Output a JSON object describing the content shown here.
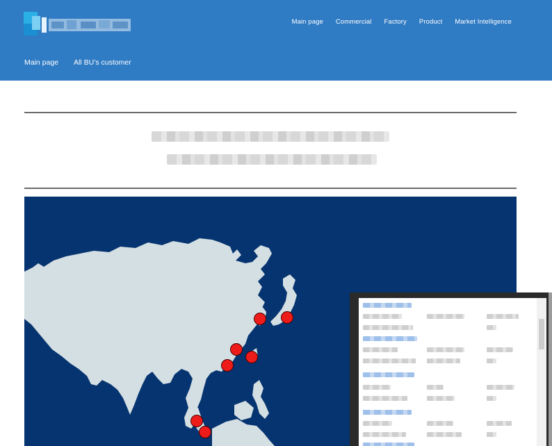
{
  "header": {
    "logo_icon": "company-logo",
    "top_nav": [
      {
        "label": "Main page"
      },
      {
        "label": "Commercial"
      },
      {
        "label": "Factory"
      },
      {
        "label": "Product"
      },
      {
        "label": "Market Intelligence"
      }
    ],
    "sub_nav": [
      {
        "label": "Main page"
      },
      {
        "label": "All BU’s customer"
      }
    ]
  },
  "colors": {
    "header_bg": "#2f7bc4",
    "map_ocean": "#063470",
    "map_land": "#d4dfe3",
    "marker": "#ee1b1b"
  },
  "map": {
    "region": "Asia",
    "marker_count": 7
  }
}
